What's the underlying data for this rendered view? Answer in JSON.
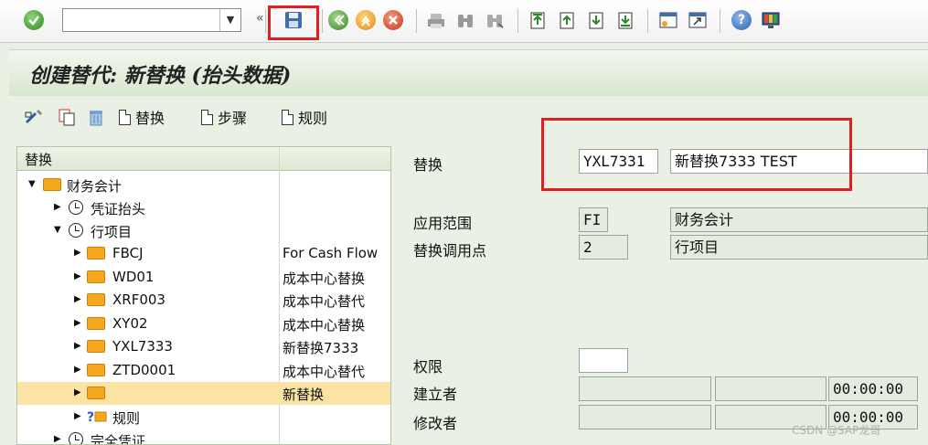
{
  "toolbar": {
    "command_field_value": "",
    "icons": [
      "enter-icon",
      "save-icon",
      "back-icon",
      "exit-icon",
      "cancel-icon",
      "print-icon",
      "find-icon",
      "find-next-icon",
      "first-page-icon",
      "previous-page-icon",
      "next-page-icon",
      "last-page-icon",
      "new-session-icon",
      "shortcut-icon",
      "help-icon",
      "customize-layout-icon"
    ]
  },
  "page": {
    "title": "创建替代: 新替换 (抬头数据)"
  },
  "app_toolbar": {
    "replacement_label": "替换",
    "step_label": "步骤",
    "rule_label": "规则"
  },
  "tree": {
    "header": {
      "col1": "替换",
      "col2": ""
    },
    "nodes": [
      {
        "label": "财务会计",
        "col2": ""
      },
      {
        "label": "凭证抬头",
        "col2": ""
      },
      {
        "label": "行项目",
        "col2": ""
      },
      {
        "label": "FBCJ",
        "col2": "For Cash Flow"
      },
      {
        "label": "WD01",
        "col2": "成本中心替换"
      },
      {
        "label": "XRF003",
        "col2": "成本中心替代"
      },
      {
        "label": "XY02",
        "col2": "成本中心替换"
      },
      {
        "label": "YXL7333",
        "col2": "新替换7333"
      },
      {
        "label": "ZTD0001",
        "col2": "成本中心替代"
      },
      {
        "label": "",
        "col2": "新替换"
      },
      {
        "label": "规则",
        "col2": ""
      },
      {
        "label": "完全凭证",
        "col2": ""
      }
    ]
  },
  "form": {
    "replacement": {
      "label": "替换",
      "code": "YXL7331",
      "description": "新替换7333 TEST"
    },
    "application_area": {
      "label": "应用范围",
      "code": "FI",
      "description": "财务会计"
    },
    "callup_point": {
      "label": "替换调用点",
      "code": "2",
      "description": "行项目"
    },
    "authorization": {
      "label": "权限",
      "value": ""
    },
    "created_by": {
      "label": "建立者",
      "user": "",
      "date": "",
      "time": "00:00:00"
    },
    "changed_by": {
      "label": "修改者",
      "user": "",
      "date": "",
      "time": "00:00:00"
    }
  },
  "watermark": "CSDN @SAP龙哥",
  "colors": {
    "highlight": "#e02020",
    "selected_row": "#fbe3a6",
    "background": "#eaf1e4"
  }
}
